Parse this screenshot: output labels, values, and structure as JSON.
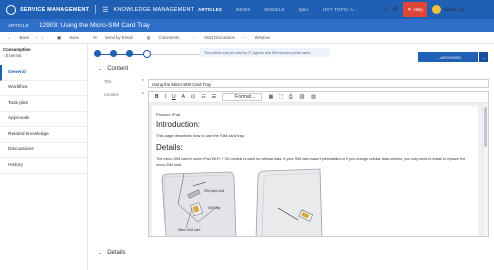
{
  "header": {
    "app_name": "SERVICE MANAGEMENT",
    "module": "KNOWLEDGE MANAGEMENT",
    "nav": [
      "ARTICLES",
      "NEWS",
      "MODELS",
      "Q&A",
      "HOT TOPIC A..."
    ],
    "help_label": "Help",
    "user_name": "Baker, Joe"
  },
  "record": {
    "type": "ARTICLE",
    "title": "12903: Using the Micro-SIM Card Tray"
  },
  "toolbar": {
    "back": "Back",
    "save": "Save",
    "send_by_email": "Send by Email",
    "comments": "Comments",
    "start_discussion": "Start Discussion",
    "more": "Window"
  },
  "left": {
    "category": "Consumption",
    "sub_category": "External",
    "nav": [
      "General",
      "Workflow",
      "Task plan",
      "Approvals",
      "Related knowledge",
      "Discussions",
      "History"
    ]
  },
  "workflow": {
    "notice": "This article may be read by IT, Agents and Self-service portal users",
    "phase_label": "ARCHIVED"
  },
  "content": {
    "section_label": "Content",
    "title_label": "Title",
    "title_value": "Using the Micro-SIM Card Tray",
    "content_label": "Content",
    "toolbar": {
      "bold": "B",
      "italic": "I",
      "underline": "U",
      "format": "Format"
    },
    "body": {
      "product": "Product: iPad",
      "intro_heading": "Introduction:",
      "intro_text": "This page describes how to use the SIM card tray.",
      "details_heading": "Details:",
      "details_text": "The micro-SIM card in some iPad Wi-Fi + 3G models is used for cellular data. If your SIM card wasn't preinstalled or if you change cellular data carriers, you may need to install or replace the micro-SIM card.",
      "diagram_labels": [
        "SIM-eject tool",
        "SIM tray",
        "Micro-SIM card"
      ]
    }
  },
  "details": {
    "section_label": "Details"
  },
  "colors": {
    "header_blue": "#1f5fb4",
    "title_blue": "#2e6fc7",
    "help_red": "#e0453a",
    "required_red": "#e0453a"
  }
}
